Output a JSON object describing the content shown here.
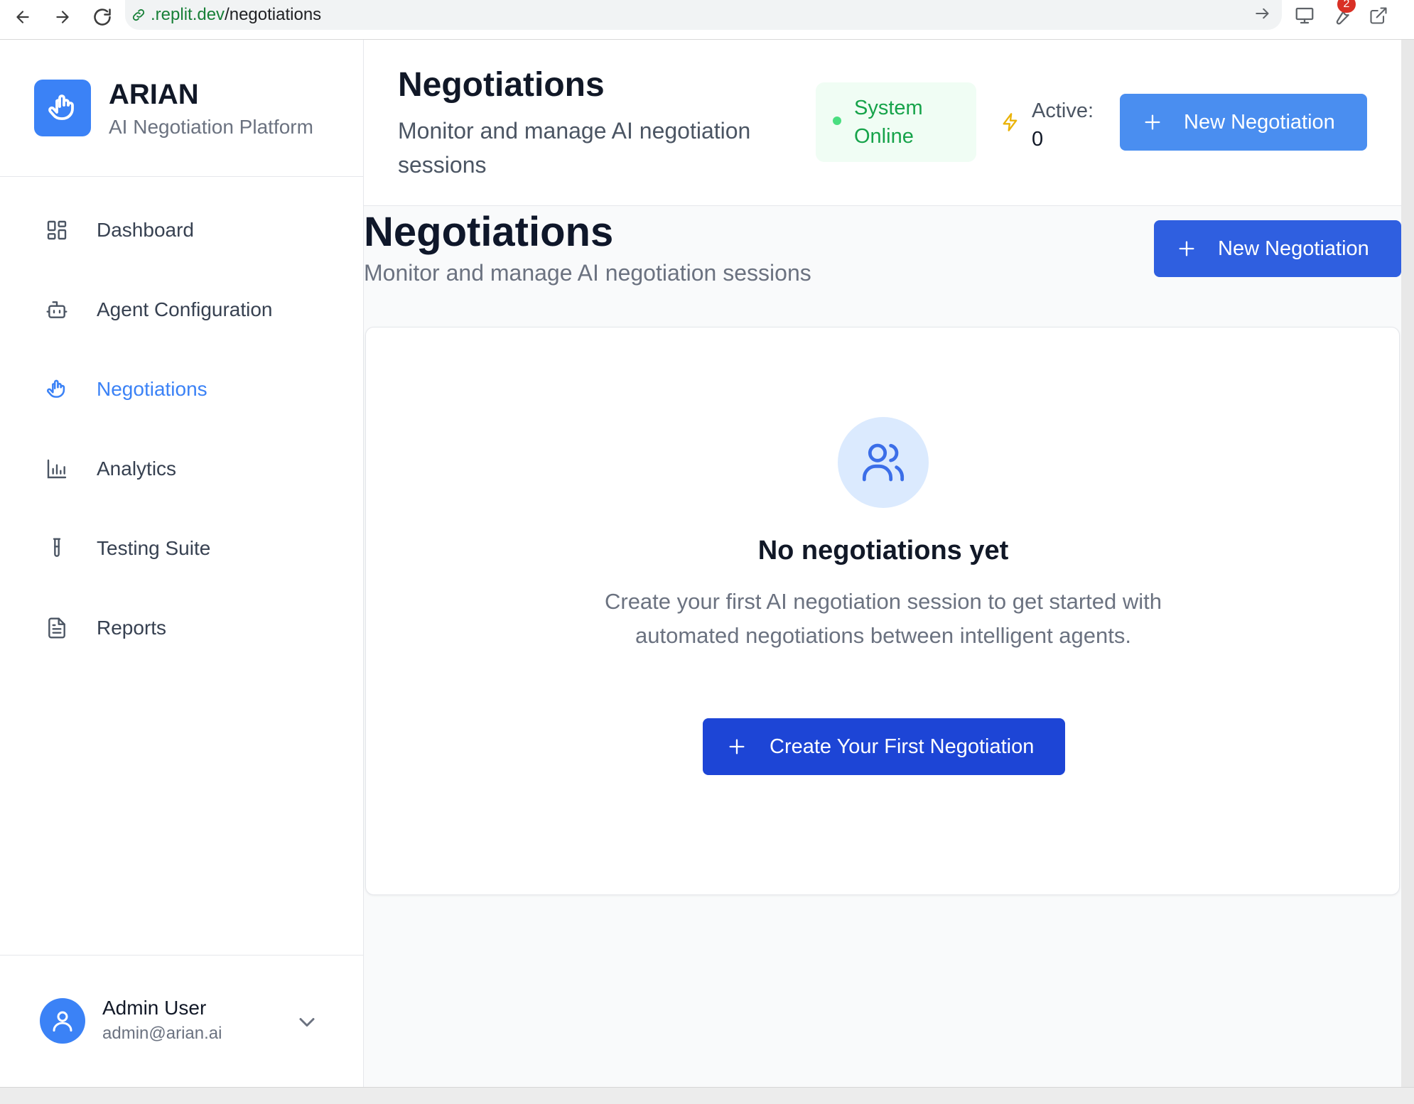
{
  "browser": {
    "url_host": ".replit.dev",
    "url_path": "/negotiations",
    "extension_badge": "2"
  },
  "brand": {
    "name": "ARIAN",
    "tagline": "AI Negotiation Platform"
  },
  "sidebar": {
    "items": [
      {
        "label": "Dashboard",
        "icon": "grid-icon",
        "active": false
      },
      {
        "label": "Agent Configuration",
        "icon": "robot-icon",
        "active": false
      },
      {
        "label": "Negotiations",
        "icon": "hand-icon",
        "active": true
      },
      {
        "label": "Analytics",
        "icon": "bar-chart-icon",
        "active": false
      },
      {
        "label": "Testing Suite",
        "icon": "test-tube-icon",
        "active": false
      },
      {
        "label": "Reports",
        "icon": "file-text-icon",
        "active": false
      }
    ]
  },
  "user": {
    "name": "Admin User",
    "email": "admin@arian.ai"
  },
  "header": {
    "title": "Negotiations",
    "subtitle": "Monitor and manage AI negotiation sessions",
    "status_label": "System Online",
    "active_label": "Active:",
    "active_count": "0",
    "new_button": "New Negotiation"
  },
  "page": {
    "title": "Negotiations",
    "subtitle": "Monitor and manage AI negotiation sessions",
    "new_button": "New Negotiation"
  },
  "empty_state": {
    "title": "No negotiations yet",
    "description": "Create your first AI negotiation session to get started with automated negotiations between intelligent agents.",
    "button": "Create Your First Negotiation"
  },
  "colors": {
    "accent": "#3b82f6",
    "primary_button": "#1d45d6",
    "status_green": "#16a34a",
    "bolt": "#eab308"
  }
}
